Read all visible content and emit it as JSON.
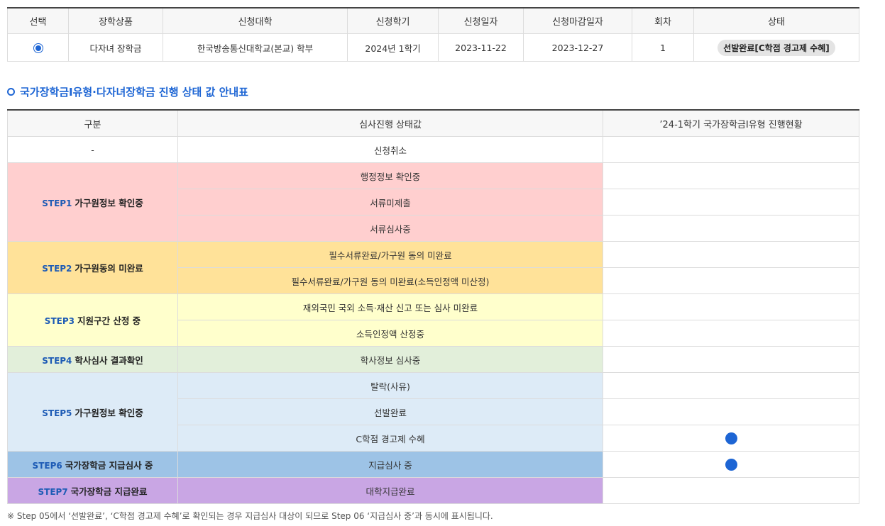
{
  "application": {
    "headers": [
      "선택",
      "장학상품",
      "신청대학",
      "신청학기",
      "신청일자",
      "신청마감일자",
      "회차",
      "상태"
    ],
    "row": {
      "product": "다자녀 장학금",
      "university": "한국방송통신대학교(본교) 학부",
      "semester": "2024년 1학기",
      "apply_date": "2023-11-22",
      "deadline": "2023-12-27",
      "round": "1",
      "status": "선발완료[C학점 경고제 수혜]"
    }
  },
  "guide": {
    "title": "국가장학금I유형·다자녀장학금 진행 상태 값 안내표",
    "headers": [
      "구분",
      "심사진행 상태값",
      "’24-1학기 국가장학금I유형 진행현황"
    ],
    "cancel": {
      "category": "-",
      "status": "신청취소"
    },
    "steps": [
      {
        "code": "STEP1",
        "label": "가구원정보 확인중",
        "color": "#ffcfcf",
        "statuses": [
          "행정정보 확인중",
          "서류미제출",
          "서류심사중"
        ]
      },
      {
        "code": "STEP2",
        "label": "가구원동의 미완료",
        "color": "#ffe299",
        "statuses": [
          "필수서류완료/가구원 동의 미완료",
          "필수서류완료/가구원 동의 미완료(소득인정액 미산정)"
        ]
      },
      {
        "code": "STEP3",
        "label": "지원구간 산정 중",
        "color": "#ffffcc",
        "statuses": [
          "재외국민 국외 소득·재산 신고 또는 심사 미완료",
          "소득인정액 산정중"
        ]
      },
      {
        "code": "STEP4",
        "label": "학사심사 결과확인",
        "color": "#e2efda",
        "statuses": [
          "학사정보 심사중"
        ]
      },
      {
        "code": "STEP5",
        "label": "가구원정보 확인중",
        "color": "#ddebf7",
        "statuses": [
          "탈락(사유)",
          "선발완료",
          "C학점 경고제 수혜"
        ]
      },
      {
        "code": "STEP6",
        "label": "국가장학금 지급심사 중",
        "color": "#9dc3e6",
        "statuses": [
          "지급심사 중"
        ]
      },
      {
        "code": "STEP7",
        "label": "국가장학금 지급완료",
        "color": "#c9a6e4",
        "statuses": [
          "대학지급완료"
        ]
      }
    ],
    "current_progress": [
      "C학점 경고제 수혜",
      "지급심사 중"
    ],
    "progress_icon": "filled-circle-icon",
    "accent_color": "#1d65d4"
  },
  "footnote": "※ Step 05에서 ‘선발완료’, ‘C학점 경고제 수혜’로 확인되는 경우 지급심사 대상이 되므로 Step 06 ‘지급심사 중’과 동시에 표시됩니다."
}
